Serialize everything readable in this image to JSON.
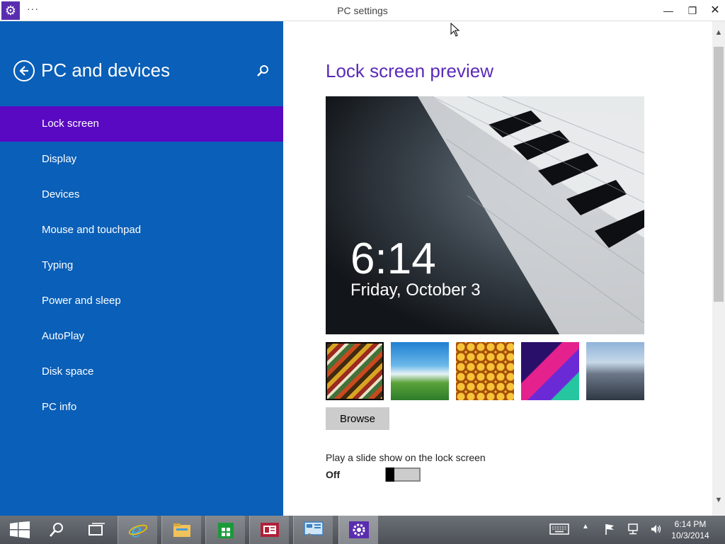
{
  "window": {
    "title": "PC settings",
    "menu_glyph": "···",
    "minimize_glyph": "—",
    "maximize_glyph": "❐",
    "close_glyph": "✕"
  },
  "sidebar": {
    "title": "PC and devices",
    "items": [
      {
        "label": "Lock screen"
      },
      {
        "label": "Display"
      },
      {
        "label": "Devices"
      },
      {
        "label": "Mouse and touchpad"
      },
      {
        "label": "Typing"
      },
      {
        "label": "Power and sleep"
      },
      {
        "label": "AutoPlay"
      },
      {
        "label": "Disk space"
      },
      {
        "label": "PC info"
      }
    ],
    "active_index": 0
  },
  "main": {
    "title": "Lock screen preview",
    "lock_time": "6:14",
    "lock_date": "Friday, October 3",
    "browse_label": "Browse",
    "slideshow_label": "Play a slide show on the lock screen",
    "slideshow_state": "Off"
  },
  "taskbar": {
    "clock_time": "6:14 PM",
    "clock_date": "10/3/2014"
  },
  "colors": {
    "sidebar_bg": "#0a5fb8",
    "sidebar_active": "#5a09c2",
    "accent_title": "#5a2ab8"
  }
}
